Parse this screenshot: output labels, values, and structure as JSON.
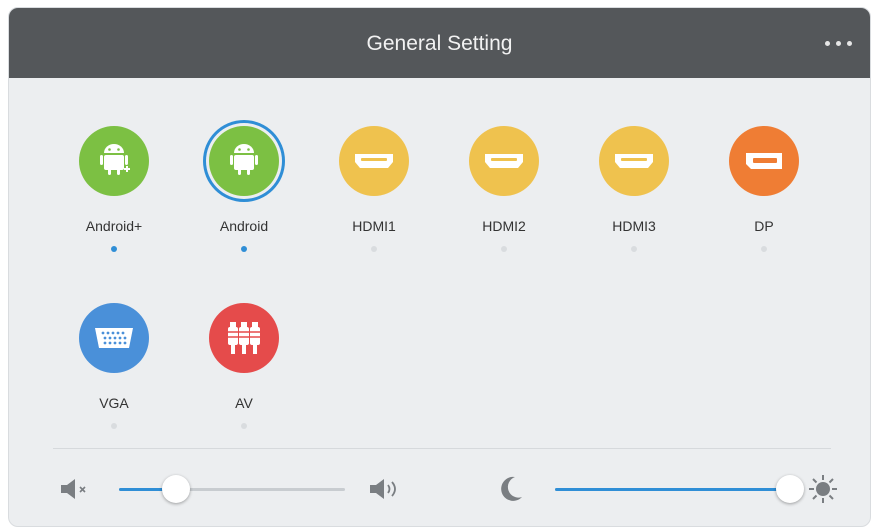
{
  "header": {
    "title": "General Setting",
    "more_icon": "more-horizontal-icon"
  },
  "sources": [
    {
      "label": "Android+",
      "icon": "android-plus-icon",
      "color": "#7cc043",
      "selected": false,
      "active": true
    },
    {
      "label": "Android",
      "icon": "android-icon",
      "color": "#7cc043",
      "selected": true,
      "active": true
    },
    {
      "label": "HDMI1",
      "icon": "hdmi-icon",
      "color": "#efc24e",
      "selected": false,
      "active": false
    },
    {
      "label": "HDMI2",
      "icon": "hdmi-icon",
      "color": "#efc24e",
      "selected": false,
      "active": false
    },
    {
      "label": "HDMI3",
      "icon": "hdmi-icon",
      "color": "#efc24e",
      "selected": false,
      "active": false
    },
    {
      "label": "DP",
      "icon": "displayport-icon",
      "color": "#ef7d34",
      "selected": false,
      "active": false
    },
    {
      "label": "VGA",
      "icon": "vga-icon",
      "color": "#4a90d9",
      "selected": false,
      "active": false
    },
    {
      "label": "AV",
      "icon": "av-rca-icon",
      "color": "#e54b4b",
      "selected": false,
      "active": false
    }
  ],
  "volume": {
    "value": 0.25,
    "min_icon": "volume-mute-icon",
    "max_icon": "volume-high-icon"
  },
  "brightness": {
    "value": 0.98,
    "min_icon": "moon-icon",
    "max_icon": "sun-icon"
  },
  "colors": {
    "accent": "#2f8ed6",
    "header": "#54575a",
    "background": "#eceef0"
  }
}
